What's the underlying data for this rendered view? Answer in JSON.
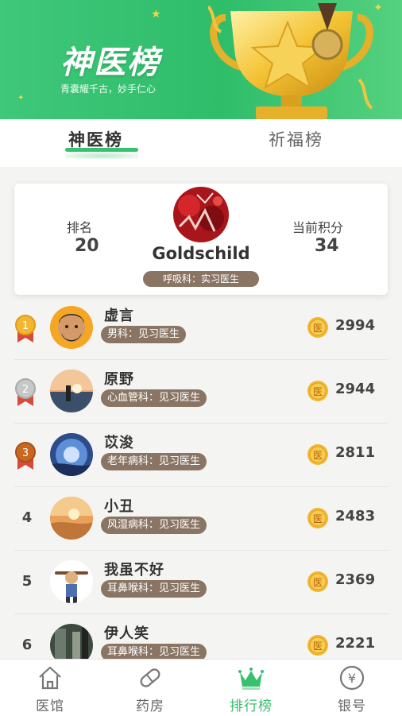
{
  "banner": {
    "title": "神医榜",
    "subtitle": "青囊耀千古，妙手仁心"
  },
  "tabs": [
    {
      "label": "神医榜",
      "active": true
    },
    {
      "label": "祈福榜",
      "active": false
    }
  ],
  "me": {
    "rank_label": "排名",
    "rank": "20",
    "score_label": "当前积分",
    "score": "34",
    "name": "Goldschild",
    "dept": "呼吸科：实习医生"
  },
  "ranking": [
    {
      "rank": "1",
      "name": "虚言",
      "dept": "男科：见习医生",
      "score": "2994",
      "medal": "gold"
    },
    {
      "rank": "2",
      "name": "原野",
      "dept": "心血管科：见习医生",
      "score": "2944",
      "medal": "silver"
    },
    {
      "rank": "3",
      "name": "苡浚",
      "dept": "老年病科：见习医生",
      "score": "2811",
      "medal": "bronze"
    },
    {
      "rank": "4",
      "name": "小丑",
      "dept": "风湿病科：见习医生",
      "score": "2483"
    },
    {
      "rank": "5",
      "name": "我虽不好",
      "dept": "耳鼻喉科：见习医生",
      "score": "2369"
    },
    {
      "rank": "6",
      "name": "伊人笑",
      "dept": "耳鼻喉科：见习医生",
      "score": "2221"
    }
  ],
  "coin_glyph": "医",
  "nav": [
    {
      "label": "医馆",
      "icon": "house-icon"
    },
    {
      "label": "药房",
      "icon": "pill-icon"
    },
    {
      "label": "排行榜",
      "icon": "crown-icon",
      "active": true
    },
    {
      "label": "银号",
      "icon": "yuan-coin-icon",
      "glyph": "¥"
    }
  ],
  "colors": {
    "brand_green": "#37c06d",
    "dept_badge": "#8a7564",
    "coin": "#f2b630"
  }
}
